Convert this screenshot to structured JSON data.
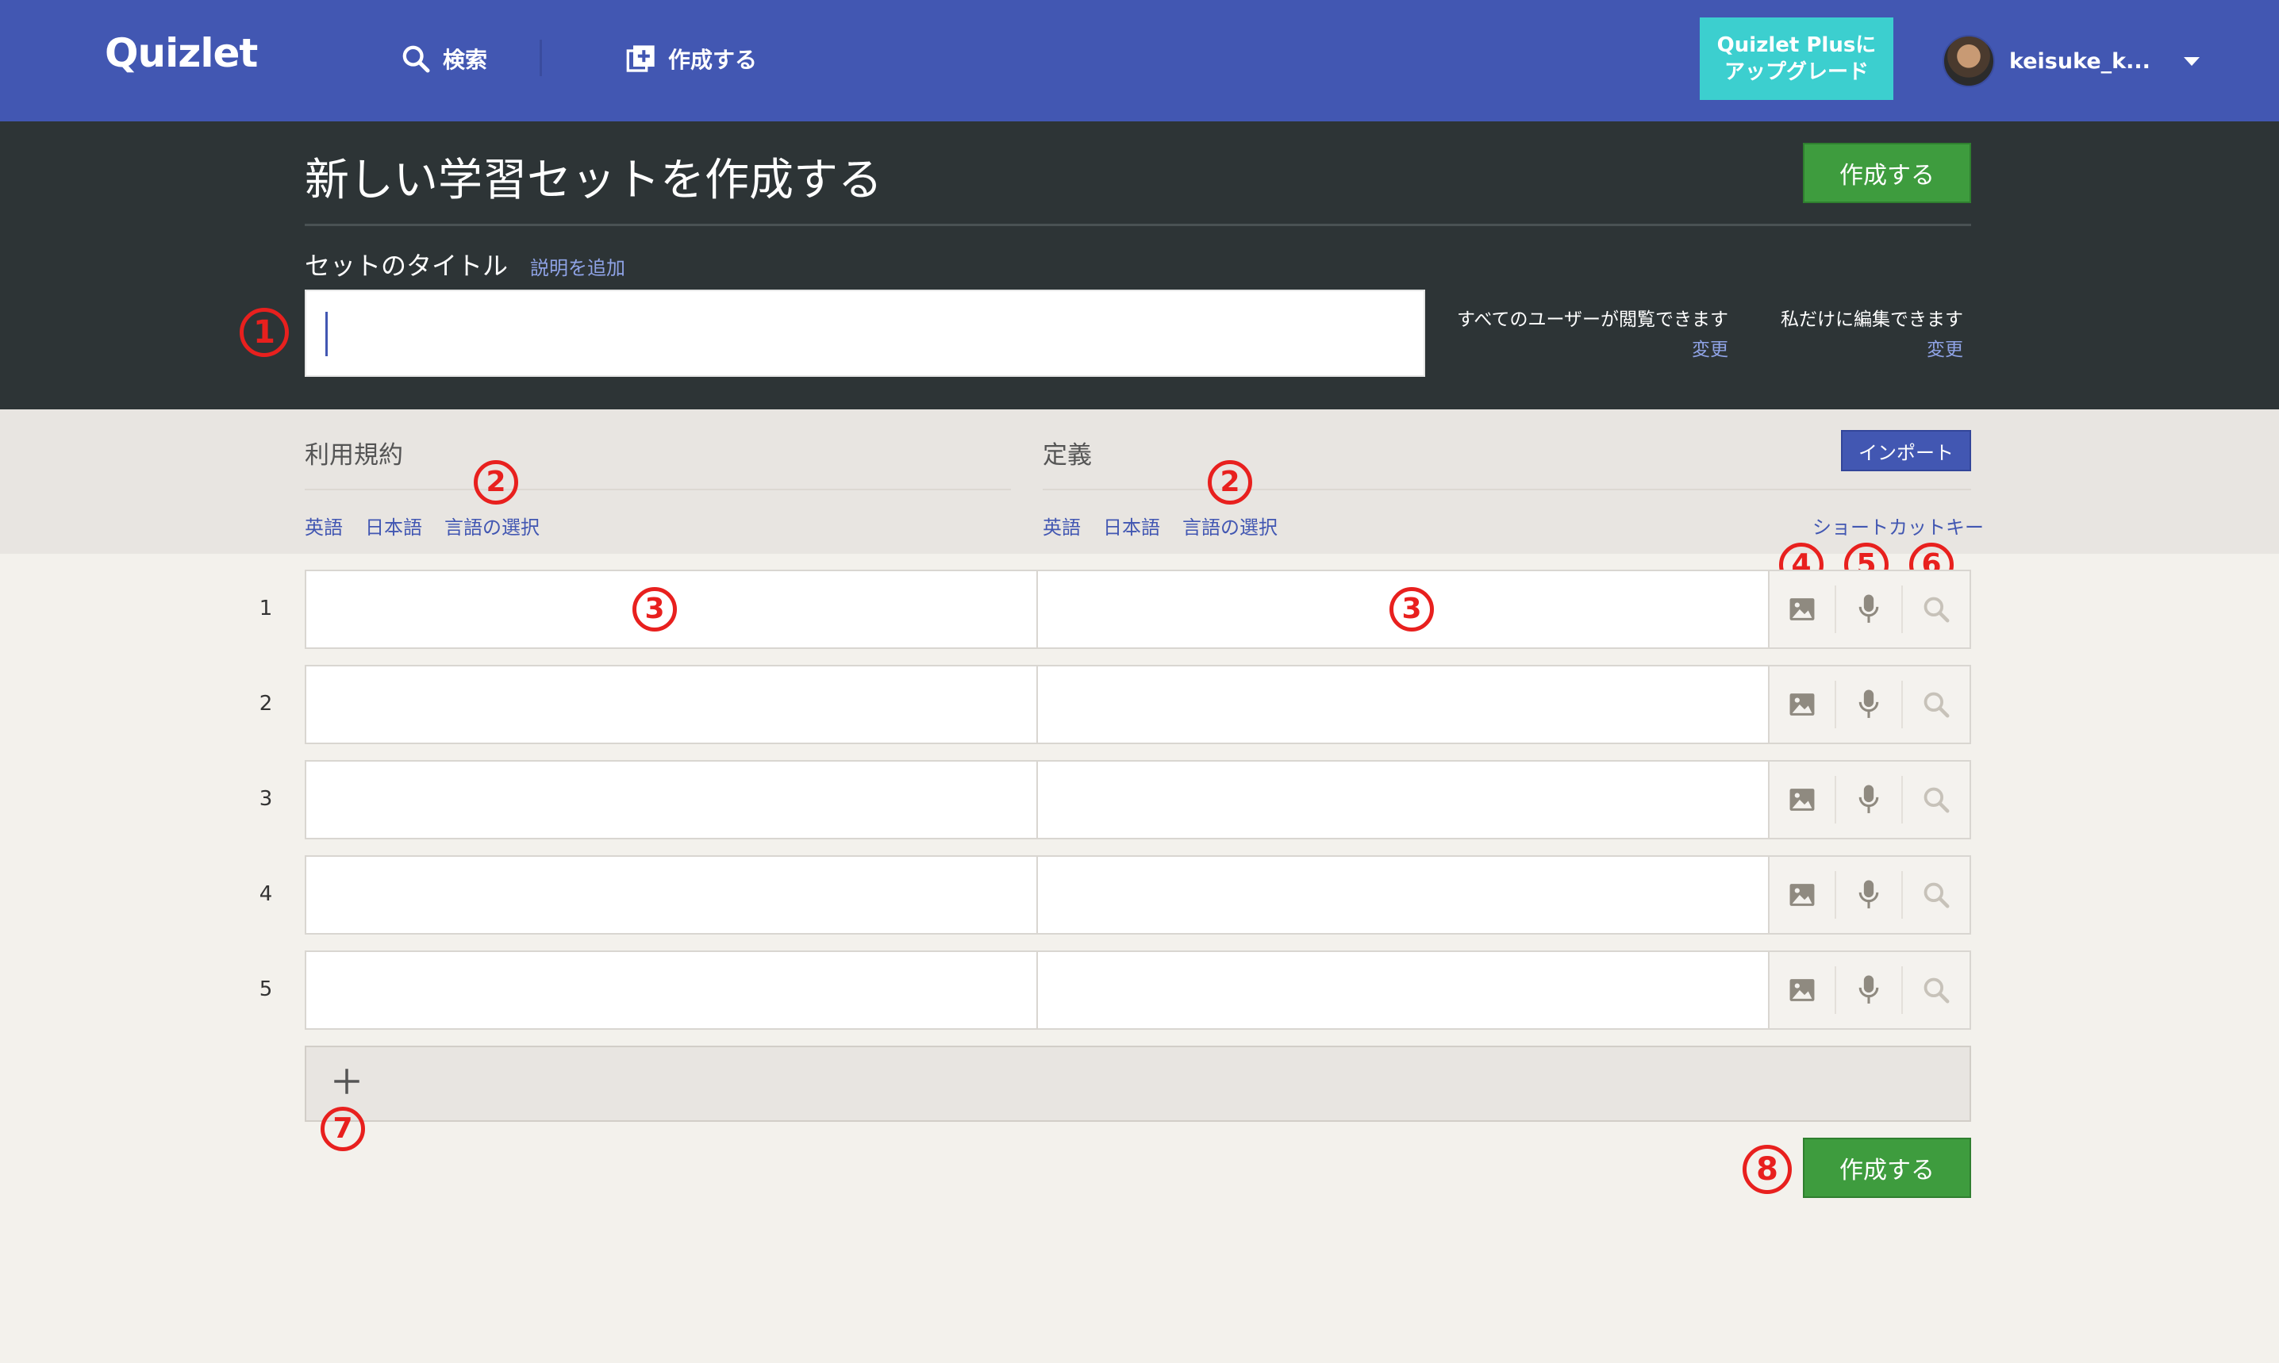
{
  "nav": {
    "logo": "Quizlet",
    "search_label": "検索",
    "create_label": "作成する",
    "upgrade_line1": "Quizlet Plusに",
    "upgrade_line2": "アップグレード",
    "username": "keisuke_k..."
  },
  "hero": {
    "title": "新しい学習セットを作成する",
    "create_label": "作成する",
    "title_label": "セットのタイトル",
    "add_description": "説明を追加",
    "title_value": "",
    "visibility_text": "すべてのユーザーが閲覧できます",
    "visibility_change": "変更",
    "edit_text": "私だけに編集できます",
    "edit_change": "変更"
  },
  "columns": {
    "terms_heading": "利用規約",
    "definition_heading": "定義",
    "term_langs": [
      "英語",
      "日本語",
      "言語の選択"
    ],
    "def_langs": [
      "英語",
      "日本語",
      "言語の選択"
    ],
    "import_label": "インポート",
    "shortcut_label": "ショートカットキー"
  },
  "rows": [
    {
      "num": "1",
      "term": "",
      "definition": ""
    },
    {
      "num": "2",
      "term": "",
      "definition": ""
    },
    {
      "num": "3",
      "term": "",
      "definition": ""
    },
    {
      "num": "4",
      "term": "",
      "definition": ""
    },
    {
      "num": "5",
      "term": "",
      "definition": ""
    }
  ],
  "footer": {
    "create_label": "作成する"
  },
  "annotations": {
    "a1": "1",
    "a2": "2",
    "a3": "3",
    "a4": "4",
    "a5": "5",
    "a6": "6",
    "a7": "7",
    "a8": "8"
  },
  "icons": {
    "image": "image-icon",
    "mic": "microphone-icon",
    "search": "search-icon",
    "add": "plus-icon"
  },
  "colors": {
    "nav_bg": "#4257b2",
    "hero_bg": "#2d3436",
    "accent_green": "#3e9c3e",
    "upgrade_teal": "#3ccfcf",
    "annotation_red": "#e8201e"
  }
}
